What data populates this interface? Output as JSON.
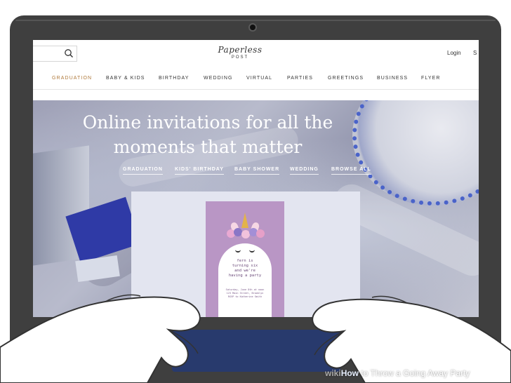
{
  "header": {
    "logo_text": "Paperless",
    "logo_sub": "POST",
    "login": "Login",
    "signup_fragment": "S"
  },
  "nav": {
    "items": [
      {
        "label": "GRADUATION",
        "active": true
      },
      {
        "label": "BABY & KIDS",
        "active": false
      },
      {
        "label": "BIRTHDAY",
        "active": false
      },
      {
        "label": "WEDDING",
        "active": false
      },
      {
        "label": "VIRTUAL",
        "active": false
      },
      {
        "label": "PARTIES",
        "active": false
      },
      {
        "label": "GREETINGS",
        "active": false
      },
      {
        "label": "BUSINESS",
        "active": false
      },
      {
        "label": "FLYER",
        "active": false
      }
    ]
  },
  "hero": {
    "title_line1": "Online invitations for all the",
    "title_line2": "moments that matter",
    "links": [
      "GRADUATION",
      "KIDS' BIRTHDAY",
      "BABY SHOWER",
      "WEDDING",
      "BROWSE ALL"
    ]
  },
  "invite_card": {
    "text_lines": [
      "fern is",
      "turning six",
      "and we're",
      "having a party"
    ],
    "small_lines": [
      "Saturday, June 8th at noon",
      "123 Main Street, Brooklyn",
      "RSVP to Katherine Smith"
    ]
  },
  "watermark": {
    "wiki": "wiki",
    "how": "How",
    "title": " to Throw a Going Away Party"
  },
  "colors": {
    "active_nav": "#b07a3c",
    "laptop": "#3f3f3f",
    "invite_bg": "#b996c5"
  },
  "icons": [
    "search-icon",
    "camera-icon"
  ]
}
